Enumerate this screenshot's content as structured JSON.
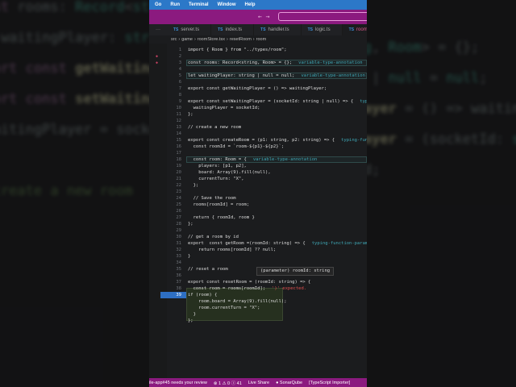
{
  "menu": [
    "Go",
    "Run",
    "Terminal",
    "Window",
    "Help"
  ],
  "nav_icons": "← →",
  "tabs": [
    {
      "label": "server.ts"
    },
    {
      "label": "index.ts"
    },
    {
      "label": "handler.ts"
    },
    {
      "label": "logic.ts"
    },
    {
      "label": "roomStore.tsx",
      "active": true
    }
  ],
  "tab_icon": "TS",
  "breadcrumb": [
    "src",
    "game",
    "roomStore.tsx",
    "resetRoom",
    "room"
  ],
  "lines": [
    {
      "n": 1,
      "t": "import { Room } from \"../types/room\";"
    },
    {
      "n": 2,
      "t": ""
    },
    {
      "n": 3,
      "t": "const rooms: Record<string, Room> = {};",
      "h": "variable-type-annotation"
    },
    {
      "n": 4,
      "t": ""
    },
    {
      "n": 5,
      "t": "let waitingPlayer: string | null = null;",
      "h": "variable-type-annotation"
    },
    {
      "n": 6,
      "t": ""
    },
    {
      "n": 7,
      "t": "export const getWaitingPlayer = () => waitingPlayer;"
    },
    {
      "n": 8,
      "t": ""
    },
    {
      "n": 9,
      "t": "export const setWaitingPlayer = (socketId: string | null) => {",
      "h": "typing-function-param"
    },
    {
      "n": 10,
      "t": "  waitingPlayer = socketId;"
    },
    {
      "n": 11,
      "t": "};"
    },
    {
      "n": 12,
      "t": ""
    },
    {
      "n": 13,
      "t": "// create a new room"
    },
    {
      "n": 14,
      "t": ""
    },
    {
      "n": 15,
      "t": "export const createRoom = (p1: string, p2: string) => {",
      "h": "typing-function-param"
    },
    {
      "n": 16,
      "t": "  const roomId = `room-${p1}-${p2}`;"
    },
    {
      "n": 17,
      "t": ""
    },
    {
      "n": 18,
      "t": "  const room: Room = {",
      "h": "variable-type-annotation"
    },
    {
      "n": 19,
      "t": "    players: [p1, p2],"
    },
    {
      "n": 20,
      "t": "    board: Array(9).fill(null),"
    },
    {
      "n": 21,
      "t": "    currentTurn: \"X\","
    },
    {
      "n": 22,
      "t": "  };"
    },
    {
      "n": 23,
      "t": ""
    },
    {
      "n": 24,
      "t": "  // Save the room"
    },
    {
      "n": 25,
      "t": "  rooms[roomId] = room;"
    },
    {
      "n": 26,
      "t": ""
    },
    {
      "n": 27,
      "t": "  return { roomId, room }"
    },
    {
      "n": 28,
      "t": "};"
    },
    {
      "n": 29,
      "t": ""
    },
    {
      "n": 30,
      "t": "// get a room by id"
    },
    {
      "n": 31,
      "t": "export  const getRoom =(roomId: string) => {",
      "h": "typing-function-param"
    },
    {
      "n": 32,
      "t": "    return rooms[roomId] ?? null;"
    },
    {
      "n": 33,
      "t": "}"
    },
    {
      "n": 34,
      "t": ""
    },
    {
      "n": 35,
      "t": "// reset a room"
    },
    {
      "n": 36,
      "t": ""
    },
    {
      "n": 37,
      "t": "export const resetRoom = (roomId: string) => {"
    },
    {
      "n": 38,
      "t": "  const room = rooms[roomId];",
      "e": "')' expected."
    },
    {
      "n": 39,
      "t": "if (room) {"
    },
    {
      "n": "",
      "t": "    room.board = Array(9).fill(null);"
    },
    {
      "n": "",
      "t": "    room.currentTurn = \"X\";"
    },
    {
      "n": "",
      "t": "  }"
    },
    {
      "n": "",
      "t": "};"
    }
  ],
  "tooltip": "(parameter) roomId: string",
  "status": {
    "review": "ile-app#45 needs your review",
    "problems": "⊗ 1 ⚠ 0 ⓘ 41",
    "liveshare": "Live Share",
    "sonar": "● SonarQube",
    "ts": "[TypeScript Importer]"
  },
  "colors": {
    "menubar": "#2c78c8",
    "titlebar": "#8b1a7f",
    "status": "#8b1a7f"
  }
}
